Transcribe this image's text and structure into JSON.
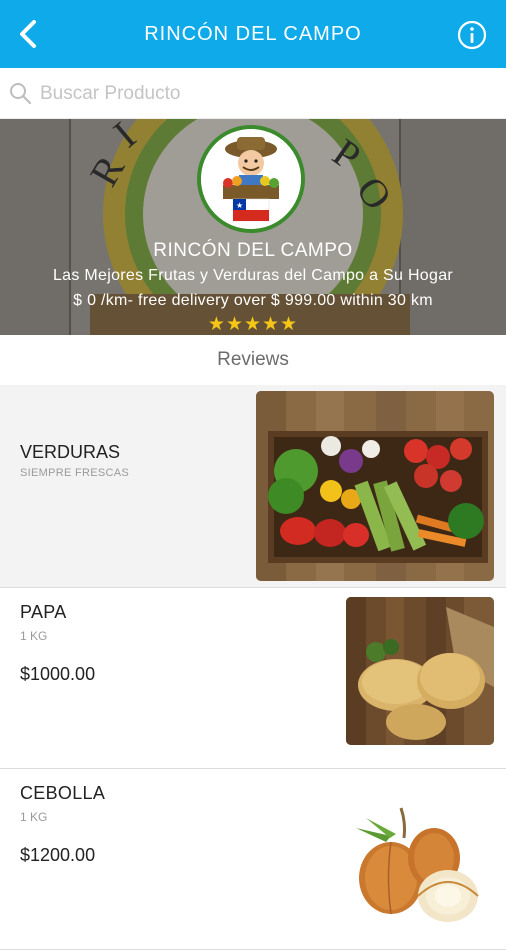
{
  "header": {
    "title": "RINCÓN DEL CAMPO",
    "back_icon": "chevron-left-icon",
    "info_icon": "info-icon",
    "background_color": "#0eaaea"
  },
  "search": {
    "placeholder": "Buscar Producto",
    "value": "",
    "icon": "search-icon"
  },
  "store": {
    "name": "RINCÓN DEL CAMPO",
    "tagline": "Las Mejores Frutas y Verduras del Campo a Su Hogar",
    "delivery": "$ 0 /km- free delivery over $ 999.00 within 30 km",
    "rating_stars": "★★★★★",
    "rating": 5
  },
  "reviews": {
    "label": "Reviews"
  },
  "category": {
    "title": "VERDURAS",
    "subtitle": "SIEMPRE FRESCAS"
  },
  "products": [
    {
      "name": "PAPA",
      "unit": "1 KG",
      "price": "$1000.00"
    },
    {
      "name": "CEBOLLA",
      "unit": "1 KG",
      "price": "$1200.00"
    }
  ]
}
